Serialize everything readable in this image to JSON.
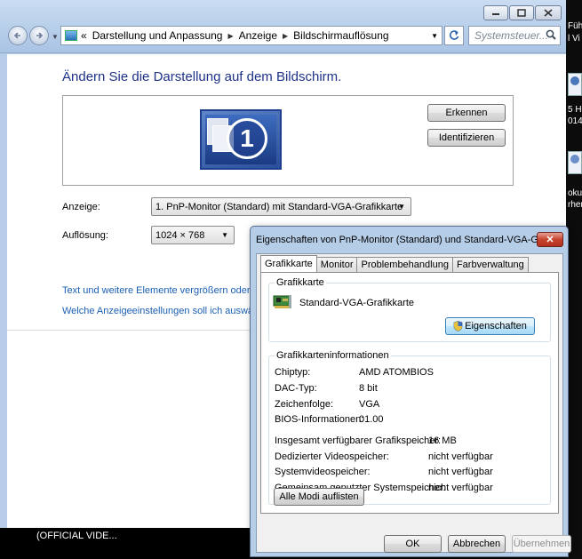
{
  "window": {
    "address": {
      "back_arrow": "«",
      "crumbs": [
        "Darstellung und Anpassung",
        "Anzeige",
        "Bildschirmauflösung"
      ]
    },
    "search_placeholder": "Systemsteuer..."
  },
  "page": {
    "heading": "Ändern Sie die Darstellung auf dem Bildschirm.",
    "monitor_number": "1",
    "detect_button": "Erkennen",
    "identify_button": "Identifizieren",
    "display_label": "Anzeige:",
    "display_value": "1. PnP-Monitor (Standard) mit Standard-VGA-Grafikkarte",
    "resolution_label": "Auflösung:",
    "resolution_value": "1024 × 768",
    "link_text_size": "Text und weitere Elemente vergrößern oder v",
    "link_display_settings": "Welche Anzeigeeinstellungen soll ich auswä"
  },
  "taskbar": {
    "item": "(OFFICIAL VIDE..."
  },
  "desktop_strip": {
    "texts": [
      "Füh",
      "l Vi",
      "5 H",
      "014",
      "oku",
      "rher"
    ]
  },
  "dialog": {
    "title": "Eigenschaften von PnP-Monitor (Standard) und Standard-VGA-Gra...",
    "close": "✕",
    "tabs": [
      "Grafikkarte",
      "Monitor",
      "Problembehandlung",
      "Farbverwaltung"
    ],
    "adapter_group_title": "Grafikkarte",
    "adapter_name": "Standard-VGA-Grafikkarte",
    "properties_button": "Eigenschaften",
    "info_group_title": "Grafikkarteninformationen",
    "info_rows": [
      {
        "label": "Chiptyp:",
        "value": "AMD ATOMBIOS"
      },
      {
        "label": "DAC-Typ:",
        "value": "8 bit"
      },
      {
        "label": "Zeichenfolge:",
        "value": "VGA"
      },
      {
        "label": "BIOS-Informationen:",
        "value": "01.00"
      }
    ],
    "memory_rows": [
      {
        "label": "Insgesamt verfügbarer Grafikspeicher:",
        "value": "16 MB"
      },
      {
        "label": "Dedizierter Videospeicher:",
        "value": "nicht verfügbar"
      },
      {
        "label": "Systemvideospeicher:",
        "value": "nicht verfügbar"
      },
      {
        "label": "Gemeinsam genutzter Systemspeicher:",
        "value": "nicht verfügbar"
      }
    ],
    "list_modes_button": "Alle Modi auflisten",
    "ok_button": "OK",
    "cancel_button": "Abbrechen",
    "apply_button": "Übernehmen"
  }
}
